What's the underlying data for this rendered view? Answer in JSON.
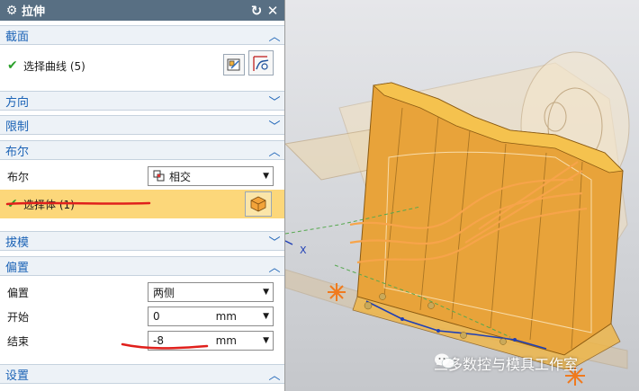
{
  "dialog": {
    "title": "拉伸",
    "reset_icon": "reset-icon",
    "close_icon": "close-icon"
  },
  "sections": {
    "section": {
      "label": "截面",
      "expanded": true
    },
    "direction": {
      "label": "方向",
      "expanded": false
    },
    "limits": {
      "label": "限制",
      "expanded": false
    },
    "boolean": {
      "label": "布尔",
      "expanded": true
    },
    "draft": {
      "label": "拔模",
      "expanded": false
    },
    "offset": {
      "label": "偏置",
      "expanded": true
    },
    "settings": {
      "label": "设置",
      "expanded": true
    }
  },
  "section_row": {
    "label": "选择曲线 (5)"
  },
  "boolean_row": {
    "label": "布尔",
    "value": "相交"
  },
  "select_body_row": {
    "label": "选择体 (1)"
  },
  "offset_rows": {
    "type_label": "偏置",
    "type_value": "两侧",
    "start_label": "开始",
    "start_value": "0",
    "start_unit": "mm",
    "end_label": "结束",
    "end_value": "-8",
    "end_unit": "mm"
  },
  "watermark": {
    "text": "三多数控与模具工作室"
  },
  "colors": {
    "title_bg": "#586f83",
    "section_label": "#1c63b6",
    "highlight_row": "#fcd77a",
    "body_orange": "#e8a33a",
    "annotation_red": "#e0201c"
  }
}
